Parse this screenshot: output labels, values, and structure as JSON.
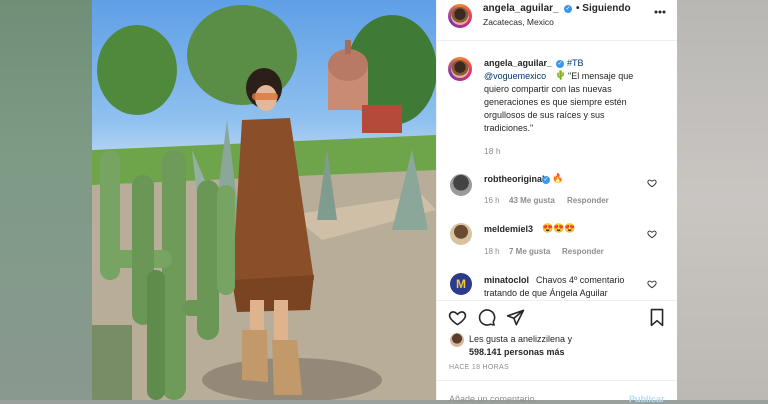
{
  "header": {
    "username": "angela_aguilar_",
    "follow_status": "• Siguiendo",
    "location": "Zacatecas, Mexico",
    "more_icon": "more-horizontal-icon"
  },
  "caption": {
    "username": "angela_aguilar_",
    "tag": "#TB",
    "mention": "@voguemexico",
    "emoji": "🌵",
    "line1": "\"El mensaje que",
    "line2": "quiero compartir con las nuevas",
    "line3": "generaciones es que siempre estén",
    "line4": "orgullosos de sus raíces y sus",
    "line5": "tradiciones.\"",
    "time": "18 h"
  },
  "comments": [
    {
      "username": "robtheoriginal",
      "text": "🔥",
      "time": "16 h",
      "likes": "43 Me gusta",
      "reply": "Responder"
    },
    {
      "username": "meldemiel3",
      "text": "😍😍😍",
      "time": "18 h",
      "likes": "7 Me gusta",
      "reply": "Responder"
    },
    {
      "username": "minatoclol",
      "text_line1": "Chavos 4º comentario",
      "text_line2": "tratando de que Ángela Aguilar"
    }
  ],
  "actions": {
    "like_icon": "heart-icon",
    "comment_icon": "comment-icon",
    "share_icon": "share-icon",
    "save_icon": "bookmark-icon"
  },
  "likes": {
    "line1": "Les gusta a anelizzilena y",
    "line2": "598.141 personas más"
  },
  "timestamp": "HACE 18 HORAS",
  "add_comment": {
    "placeholder": "Añade un comentario...",
    "publish": "Publicar"
  },
  "colors": {
    "accent": "#0095f6",
    "verified": "#3897f0",
    "border": "#efefef"
  }
}
